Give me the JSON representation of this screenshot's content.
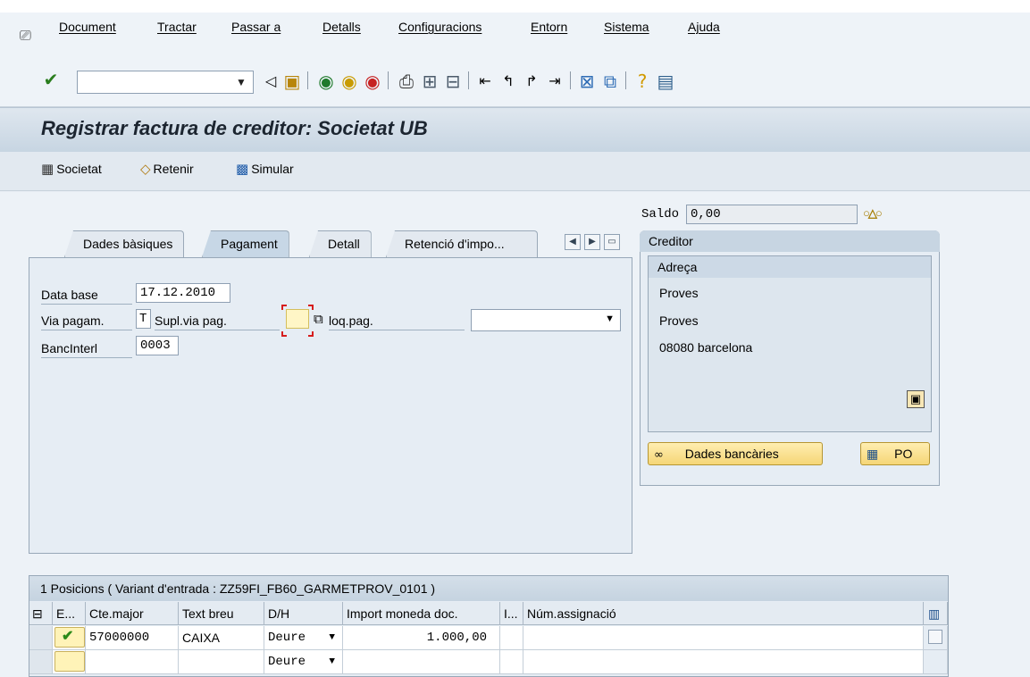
{
  "menu": {
    "items": [
      "Document",
      "Tractar",
      "Passar a",
      "Detalls",
      "Configuracions",
      "Entorn",
      "Sistema",
      "Ajuda"
    ]
  },
  "toolbar": {
    "command_value": "",
    "icons": [
      "enter-icon",
      "back-icon",
      "save-icon",
      "green-back-icon",
      "exit-icon",
      "cancel-icon",
      "print-icon",
      "find-icon",
      "find-next-icon",
      "first-page-icon",
      "prev-page-icon",
      "next-page-icon",
      "last-page-icon",
      "new-session-icon",
      "shortcut-icon",
      "help-icon",
      "layout-icon"
    ]
  },
  "title": "Registrar factura de creditor: Societat UB",
  "app_toolbar": {
    "societat": "Societat",
    "retenir": "Retenir",
    "simular": "Simular"
  },
  "tabs": {
    "items": [
      "Dades bàsiques",
      "Pagament",
      "Detall",
      "Retenció d'impo..."
    ],
    "active": "Pagament"
  },
  "payment": {
    "data_base_label": "Data base",
    "data_base_value": "17.12.2010",
    "via_pagam_label": "Via pagam.",
    "via_pagam_value": "T",
    "supl_via_pag_label": "Supl.via pag.",
    "supl_via_pag_value": "",
    "bloq_pag_label": "loq.pag.",
    "bloq_pag_value": "",
    "banc_interl_label": "BancInterl",
    "banc_interl_value": "0003"
  },
  "saldo": {
    "label": "Saldo",
    "value": "0,00",
    "status_icon": "balance-lights-icon"
  },
  "creditor": {
    "header": "Creditor",
    "address_header": "Adreça",
    "lines": [
      "Proves",
      "Proves",
      "08080 barcelona"
    ],
    "bank_data_button": "Dades bancàries",
    "po_button": "PO"
  },
  "table": {
    "title": "1 Posicions ( Variant d'entrada : ZZ59FI_FB60_GARMETPROV_0101 )",
    "columns": [
      "E...",
      "Cte.major",
      "Text breu",
      "D/H",
      "Import moneda doc.",
      "I...",
      "Núm.assignació"
    ],
    "rows": [
      {
        "gl_account": "57000000",
        "short_text": "CAIXA",
        "dh": "Deure",
        "amount": "1.000,00",
        "assignment": ""
      },
      {
        "gl_account": "",
        "short_text": "",
        "dh": "Deure",
        "amount": "",
        "assignment": ""
      }
    ]
  },
  "colors": {
    "accent_yellow": "#f5d677",
    "title_bg": "#c7d5e2",
    "required_red": "#d61d1d"
  }
}
